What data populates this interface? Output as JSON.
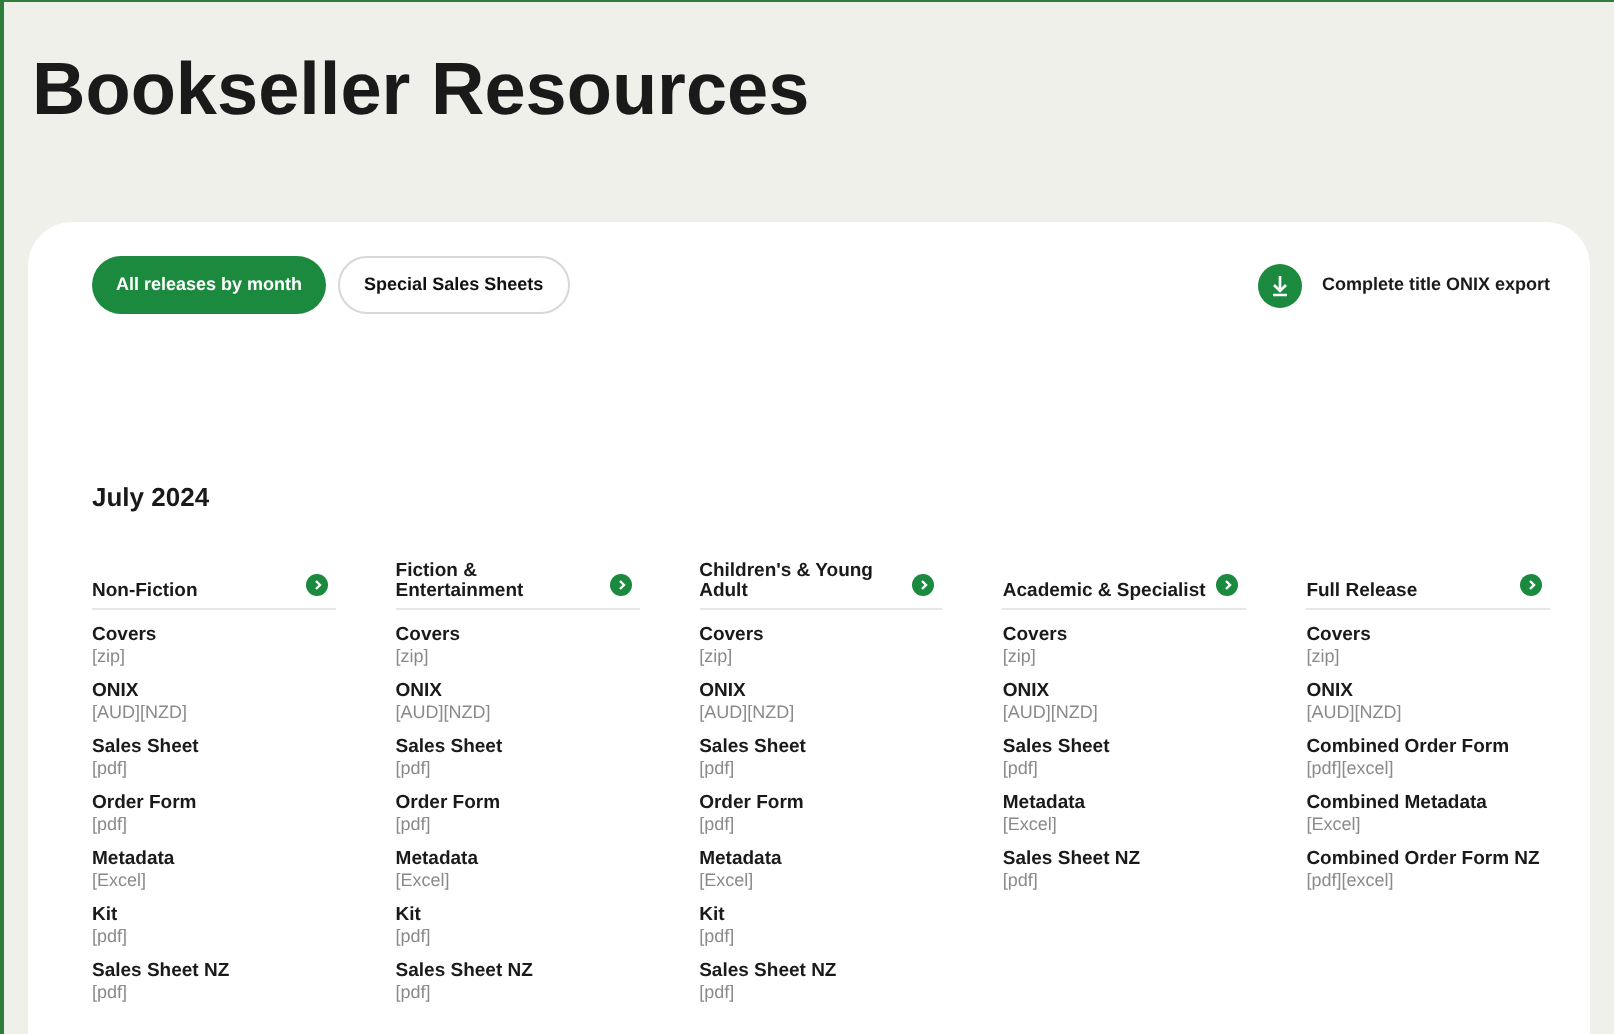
{
  "page_title": "Bookseller Resources",
  "tabs": [
    {
      "label": "All releases by month",
      "selected": true
    },
    {
      "label": "Special Sales Sheets",
      "selected": false
    }
  ],
  "export_button": {
    "label": "Complete title ONIX export"
  },
  "month": "July 2024",
  "categories": [
    {
      "title": "Non-Fiction",
      "items": [
        {
          "name": "Covers",
          "files": "[zip]"
        },
        {
          "name": "ONIX",
          "files": "[AUD][NZD]"
        },
        {
          "name": "Sales Sheet",
          "files": "[pdf]"
        },
        {
          "name": "Order Form",
          "files": "[pdf]"
        },
        {
          "name": "Metadata",
          "files": "[Excel]"
        },
        {
          "name": "Kit",
          "files": "[pdf]"
        },
        {
          "name": "Sales Sheet NZ",
          "files": "[pdf]"
        }
      ]
    },
    {
      "title": "Fiction & Entertainment",
      "items": [
        {
          "name": "Covers",
          "files": "[zip]"
        },
        {
          "name": "ONIX",
          "files": "[AUD][NZD]"
        },
        {
          "name": "Sales Sheet",
          "files": "[pdf]"
        },
        {
          "name": "Order Form",
          "files": "[pdf]"
        },
        {
          "name": "Metadata",
          "files": "[Excel]"
        },
        {
          "name": "Kit",
          "files": "[pdf]"
        },
        {
          "name": "Sales Sheet NZ",
          "files": "[pdf]"
        }
      ]
    },
    {
      "title": "Children's & Young Adult",
      "items": [
        {
          "name": "Covers",
          "files": "[zip]"
        },
        {
          "name": "ONIX",
          "files": "[AUD][NZD]"
        },
        {
          "name": "Sales Sheet",
          "files": "[pdf]"
        },
        {
          "name": "Order Form",
          "files": "[pdf]"
        },
        {
          "name": "Metadata",
          "files": "[Excel]"
        },
        {
          "name": "Kit",
          "files": "[pdf]"
        },
        {
          "name": "Sales Sheet NZ",
          "files": "[pdf]"
        }
      ]
    },
    {
      "title": "Academic & Specialist",
      "items": [
        {
          "name": "Covers",
          "files": "[zip]"
        },
        {
          "name": "ONIX",
          "files": "[AUD][NZD]"
        },
        {
          "name": "Sales Sheet",
          "files": "[pdf]"
        },
        {
          "name": "Metadata",
          "files": "[Excel]"
        },
        {
          "name": "Sales Sheet NZ",
          "files": "[pdf]"
        }
      ]
    },
    {
      "title": "Full Release",
      "items": [
        {
          "name": "Covers",
          "files": "[zip]"
        },
        {
          "name": "ONIX",
          "files": "[AUD][NZD]"
        },
        {
          "name": "Combined Order Form",
          "files": "[pdf][excel]"
        },
        {
          "name": "Combined Metadata",
          "files": "[Excel]"
        },
        {
          "name": "Combined Order Form NZ",
          "files": "[pdf][excel]"
        }
      ]
    }
  ]
}
